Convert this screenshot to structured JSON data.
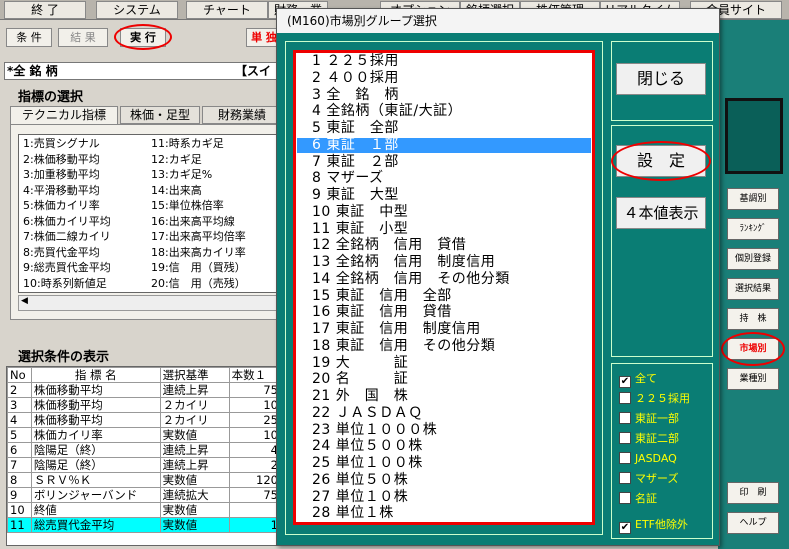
{
  "menubar": {
    "items": [
      "終 了",
      "システム",
      "チャート",
      "財務・業績",
      "オプション",
      "銘柄選択",
      "株価管理",
      "リアルタイム",
      "会員サイト"
    ]
  },
  "toolbar": {
    "cond": "条 件",
    "result": "結 果",
    "run": "実 行",
    "single": "単 独"
  },
  "all_stocks": "*全 銘 柄",
  "sui": "【スイ",
  "indicator": {
    "title": "指標の選択",
    "tabs": [
      "テクニカル指標",
      "株価・足型",
      "財務業績"
    ],
    "left": [
      "1:売買シグナル",
      "2:株価移動平均",
      "3:加重移動平均",
      "4:平滑移動平均",
      "5:株価カイリ率",
      "6:株価カイリ平均",
      "7:株価二線カイリ",
      "8:売買代金平均",
      "9:総売買代金平均",
      "10:時系列新値足"
    ],
    "right": [
      "11:時系カギ足",
      "12:カギ足",
      "13:カギ足%",
      "14:出来高",
      "15:単位株倍率",
      "16:出来高平均線",
      "17:出来高平均倍率",
      "18:出来高カイリ率",
      "19:信　用（買残）",
      "20:信　用（売残）"
    ]
  },
  "conditions": {
    "title": "選択条件の表示",
    "headers": [
      "No",
      "指 標 名",
      "選択基準",
      "本数１"
    ],
    "rows": [
      [
        "2",
        "株価移動平均",
        "連続上昇",
        "75"
      ],
      [
        "3",
        "株価移動平均",
        "２カイリ",
        "10"
      ],
      [
        "4",
        "株価移動平均",
        "２カイリ",
        "25"
      ],
      [
        "5",
        "株価カイリ率",
        "実数値",
        "10"
      ],
      [
        "6",
        "陰陽足（終）",
        "連続上昇",
        "4"
      ],
      [
        "7",
        "陰陽足（終）",
        "連続上昇",
        "2"
      ],
      [
        "8",
        "ＳＲＶ％Ｋ",
        "実数値",
        "120"
      ],
      [
        "9",
        "ボリンジャーバンド",
        "連続拡大",
        "75"
      ],
      [
        "10",
        "終値",
        "実数値",
        ""
      ],
      [
        "11",
        "総売買代金平均",
        "実数値",
        "1"
      ]
    ]
  },
  "rightstrip": {
    "buttons": [
      "基調別",
      "ﾗﾝｷﾝｸﾞ",
      "個別登録",
      "選択結果",
      "持　株",
      "市場別",
      "業種別",
      "印　刷",
      "ヘルプ"
    ]
  },
  "dialog": {
    "title": "(M160)市場別グループ選択",
    "items": [
      "1 ２２５採用",
      "2 ４００採用",
      "3 全　銘　柄",
      "4 全銘柄（東証/大証）",
      "5 東証　全部",
      "6 東証　１部",
      "7 東証　２部",
      "8 マザーズ",
      "9 東証　大型",
      "10 東証　中型",
      "11 東証　小型",
      "12 全銘柄　信用　貸借",
      "13 全銘柄　信用　制度信用",
      "14 全銘柄　信用　その他分類",
      "15 東証　信用　全部",
      "16 東証　信用　貸借",
      "17 東証　信用　制度信用",
      "18 東証　信用　その他分類",
      "19 大　　　証",
      "20 名　　　証",
      "21 外　国　株",
      "22 ＪＡＳＤＡＱ",
      "23 単位１０００株",
      "24 単位５００株",
      "25 単位１００株",
      "26 単位５０株",
      "27 単位１０株",
      "28 単位１株"
    ],
    "close": "閉じる",
    "set": "設　定",
    "fourprice": "４本値表示",
    "checks": [
      {
        "label": "全て",
        "checked": true
      },
      {
        "label": "２２５採用",
        "checked": false
      },
      {
        "label": "東証一部",
        "checked": false
      },
      {
        "label": "東証二部",
        "checked": false
      },
      {
        "label": "JASDAQ",
        "checked": false
      },
      {
        "label": "マザーズ",
        "checked": false
      },
      {
        "label": "名証",
        "checked": false
      },
      {
        "label": "ETF他除外",
        "checked": true
      }
    ],
    "checkmark": "✔"
  }
}
